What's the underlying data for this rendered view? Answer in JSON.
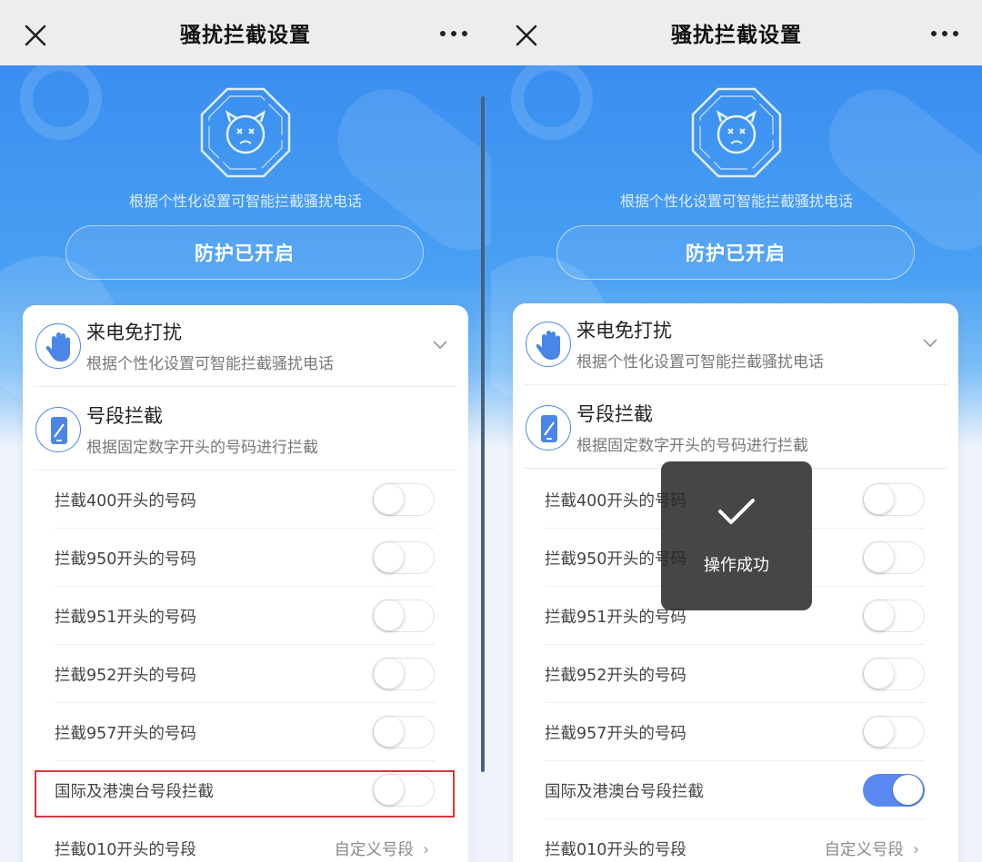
{
  "nav": {
    "title": "骚扰拦截设置"
  },
  "hero": {
    "subtitle": "根据个性化设置可智能拦截骚扰电话",
    "status_button": "防护已开启"
  },
  "features": [
    {
      "title": "来电免打扰",
      "desc": "根据个性化设置可智能拦截骚扰电话",
      "icon": "hand-icon"
    },
    {
      "title": "号段拦截",
      "desc": "根据固定数字开头的号码进行拦截",
      "icon": "phone-icon"
    }
  ],
  "options": [
    {
      "label": "拦截400开头的号码"
    },
    {
      "label": "拦截950开头的号码"
    },
    {
      "label": "拦截951开头的号码"
    },
    {
      "label": "拦截952开头的号码"
    },
    {
      "label": "拦截957开头的号码"
    },
    {
      "label": "国际及港澳台号段拦截"
    },
    {
      "label": "拦截010开头的号段",
      "action": "自定义号段"
    }
  ],
  "state": {
    "left_screen": {
      "intl_toggle": "off"
    },
    "right_screen": {
      "intl_toggle": "on"
    }
  },
  "toast": {
    "text": "操作成功"
  },
  "colors": {
    "hero_blue": "#3a8ef0",
    "toggle_on": "#5b88f0",
    "highlight_red": "#d9363e"
  }
}
